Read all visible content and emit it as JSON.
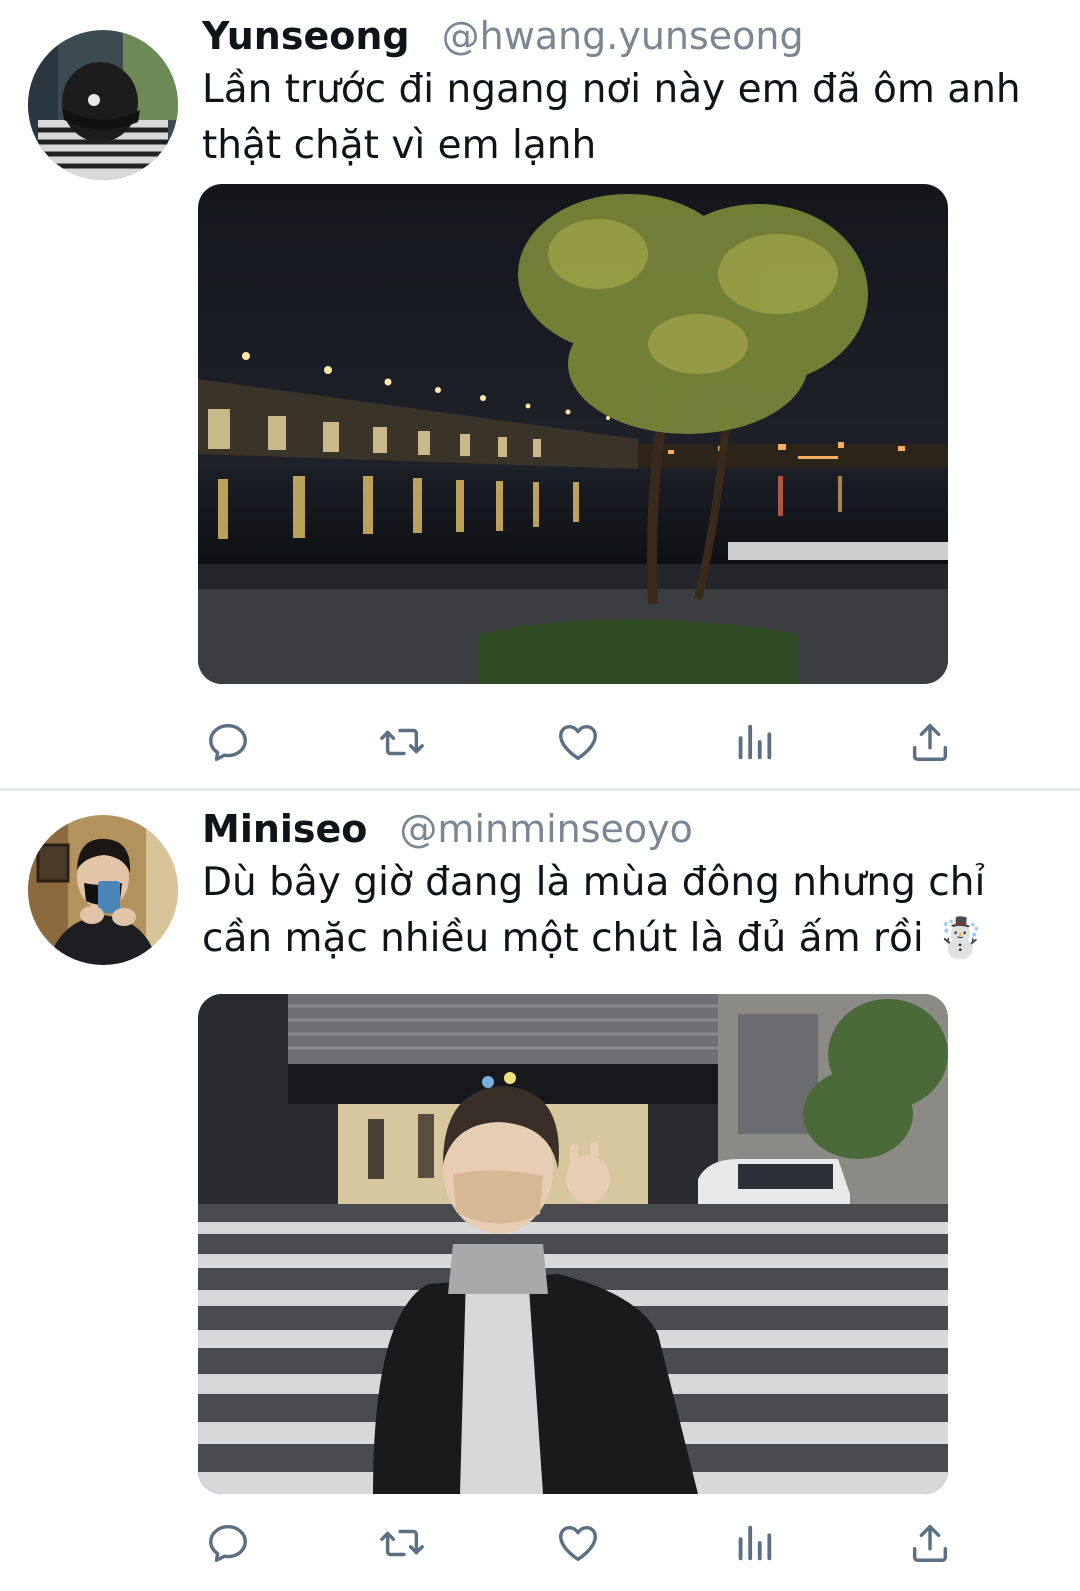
{
  "colors": {
    "name": "#0f1419",
    "secondary": "#7a8793",
    "icon": "#5b7083",
    "divider": "#e6e9ec"
  },
  "tweets": [
    {
      "display_name": "Yunseong",
      "handle": "@hwang.yunseong",
      "text": "Lần trước đi ngang nơi này em đã ôm anh thật chặt vì em lạnh",
      "media": "river-bridge-night-photo",
      "actions": [
        "reply-icon",
        "retweet-icon",
        "like-icon",
        "views-icon",
        "share-icon"
      ]
    },
    {
      "display_name": "Miniseo",
      "handle": "@minminseoyo",
      "text": "Dù bây giờ đang là mùa đông nhưng chỉ cần mặc nhiều một chút là đủ ấm rồi ☃️",
      "media": "street-crosswalk-night-photo",
      "actions": [
        "reply-icon",
        "retweet-icon",
        "like-icon",
        "views-icon",
        "share-icon"
      ]
    }
  ]
}
